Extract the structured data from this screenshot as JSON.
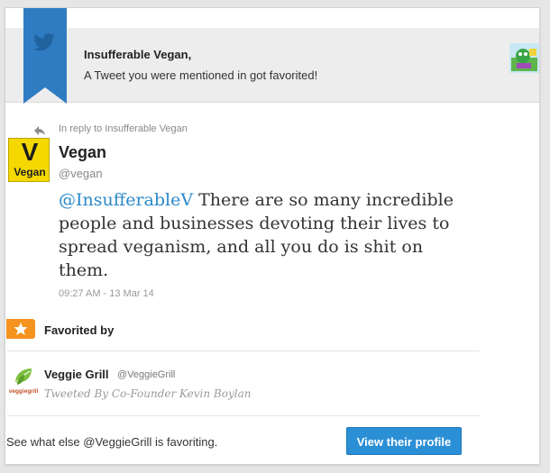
{
  "notification": {
    "title": "Insufferable Vegan,",
    "subtitle": "A Tweet you were mentioned in got favorited!",
    "ribbon_icon": "twitter-bird-icon",
    "accent_color": "#2f7cc2"
  },
  "tweet": {
    "in_reply_to": "In reply to Insufferable Vegan",
    "author_name": "Vegan",
    "author_handle": "@vegan",
    "avatar_letter": "V",
    "avatar_word": "Vegan",
    "mention": "@InsufferableV",
    "text": " There are so many incredible people and businesses devoting their lives to spread veganism, and all you do is shit on them.",
    "timestamp": "09:27 AM - 13 Mar 14"
  },
  "favorited": {
    "label": "Favorited by",
    "badge_icon": "star-icon",
    "badge_color": "#f5931e"
  },
  "favoriter": {
    "name": "Veggie Grill",
    "handle": "@VeggieGrill",
    "bio": "Tweeted By Co-Founder Kevin Boylan",
    "logo_text": "veggiegrill"
  },
  "footer": {
    "text": "See what else @VeggieGrill is favoriting.",
    "button_label": "View their profile",
    "button_color": "#2b8fd6"
  }
}
